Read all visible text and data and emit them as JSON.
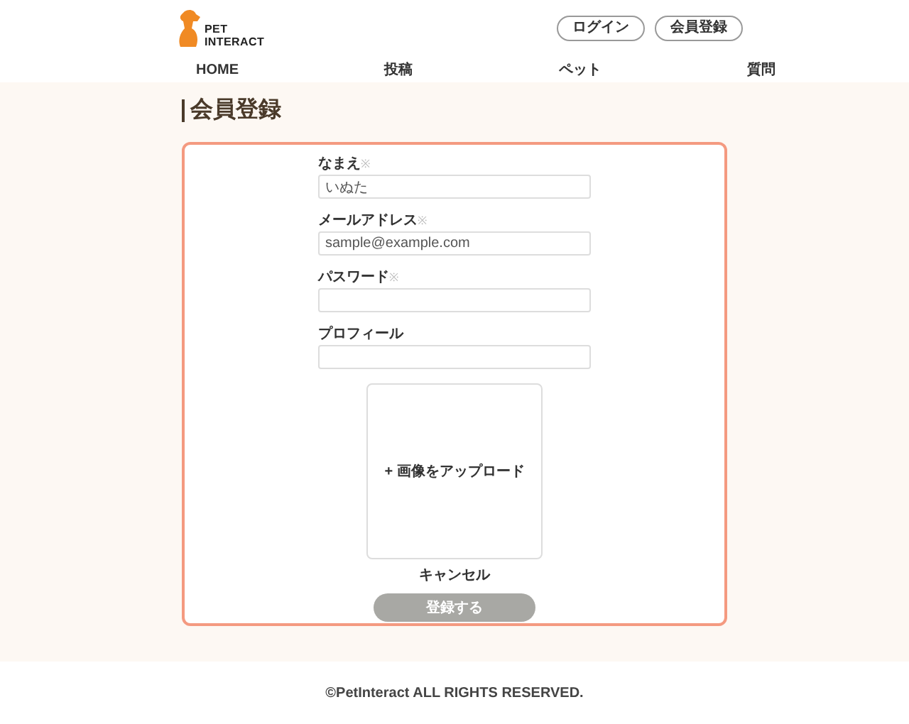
{
  "logo": {
    "line1": "PET",
    "line2": "INTERACT"
  },
  "header_buttons": [
    "ログイン",
    "会員登録"
  ],
  "nav": [
    "HOME",
    "投稿",
    "ペット",
    "質問"
  ],
  "page_title": "会員登録",
  "fields": [
    {
      "label": "なまえ",
      "required": true,
      "value": "いぬた"
    },
    {
      "label": "メールアドレス",
      "required": true,
      "value": "sample@example.com"
    },
    {
      "label": "パスワード",
      "required": true
    },
    {
      "label": "プロフィール",
      "required": false
    }
  ],
  "required_mark": "※",
  "upload": {
    "label": "+ 画像をアップロード"
  },
  "cancel": "キャンセル",
  "submit": {
    "label": "登録する",
    "disabled": true
  },
  "footer": "©PetInteract ALL RIGHTS RESERVED."
}
